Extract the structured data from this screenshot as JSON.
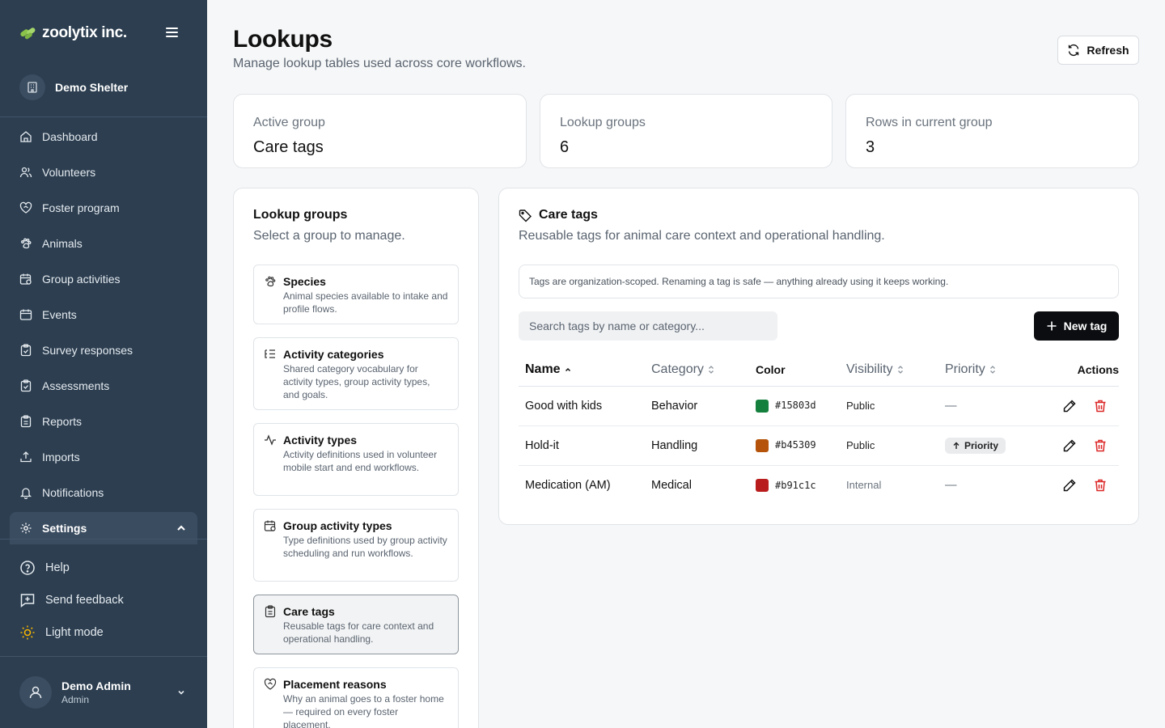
{
  "brand": {
    "name": "zoolytix inc."
  },
  "org": {
    "name": "Demo Shelter"
  },
  "nav": {
    "items": [
      {
        "label": "Dashboard"
      },
      {
        "label": "Volunteers"
      },
      {
        "label": "Foster program"
      },
      {
        "label": "Animals"
      },
      {
        "label": "Group activities"
      },
      {
        "label": "Events"
      },
      {
        "label": "Survey responses"
      },
      {
        "label": "Assessments"
      },
      {
        "label": "Reports"
      },
      {
        "label": "Imports"
      },
      {
        "label": "Notifications"
      },
      {
        "label": "Settings"
      }
    ]
  },
  "bottom_links": {
    "help": "Help",
    "feedback": "Send feedback",
    "theme": "Light mode"
  },
  "user": {
    "name": "Demo Admin",
    "role": "Admin"
  },
  "page": {
    "title": "Lookups",
    "subtitle": "Manage lookup tables used across core workflows.",
    "refresh_label": "Refresh"
  },
  "stats": [
    {
      "label": "Active group",
      "value": "Care tags"
    },
    {
      "label": "Lookup groups",
      "value": "6"
    },
    {
      "label": "Rows in current group",
      "value": "3"
    }
  ],
  "groups": {
    "title": "Lookup groups",
    "subtitle": "Select a group to manage.",
    "items": [
      {
        "title": "Species",
        "desc": "Animal species available to intake and profile flows.",
        "icon": "paw-icon"
      },
      {
        "title": "Activity categories",
        "desc": "Shared category vocabulary for activity types, group activity types, and goals.",
        "icon": "list-tree-icon"
      },
      {
        "title": "Activity types",
        "desc": "Activity definitions used in volunteer mobile start and end workflows.",
        "icon": "activity-icon"
      },
      {
        "title": "Group activity types",
        "desc": "Type definitions used by group activity scheduling and run workflows.",
        "icon": "calendar-clock-icon"
      },
      {
        "title": "Care tags",
        "desc": "Reusable tags for care context and operational handling.",
        "icon": "clipboard-icon"
      },
      {
        "title": "Placement reasons",
        "desc": "Why an animal goes to a foster home — required on every foster placement.",
        "icon": "heart-handshake-icon"
      }
    ]
  },
  "detail": {
    "title": "Care tags",
    "subtitle": "Reusable tags for animal care context and operational handling.",
    "notice": "Tags are organization-scoped. Renaming a tag is safe — anything already using it keeps working.",
    "search_placeholder": "Search tags by name or category...",
    "new_label": "New tag",
    "columns": {
      "name": "Name",
      "category": "Category",
      "color": "Color",
      "visibility": "Visibility",
      "priority": "Priority",
      "actions": "Actions"
    },
    "rows": [
      {
        "name": "Good with kids",
        "category": "Behavior",
        "color": "#15803d",
        "visibility": "Public",
        "priority": "—"
      },
      {
        "name": "Hold-it",
        "category": "Handling",
        "color": "#b45309",
        "visibility": "Public",
        "priority": "Priority"
      },
      {
        "name": "Medication (AM)",
        "category": "Medical",
        "color": "#b91c1c",
        "visibility": "Internal",
        "priority": "—"
      }
    ]
  },
  "colors": {
    "sidebar": "#2c3e50",
    "brand_green": "#8bc34a",
    "primary": "#0b0d10",
    "danger": "#dc2626"
  }
}
